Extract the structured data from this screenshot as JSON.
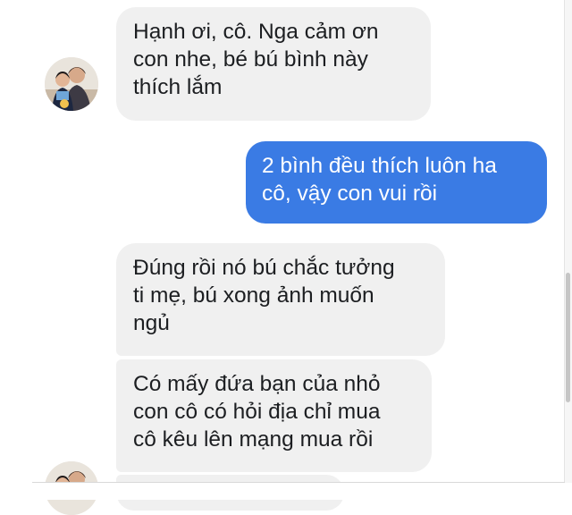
{
  "conversation": {
    "messages": [
      {
        "sender": "contact",
        "text": "Hạnh ơi, cô. Nga cảm ơn\ncon nhe, bé bú bình này\nthích lắm"
      },
      {
        "sender": "me",
        "text": "2 bình đều thích luôn ha\ncô, vậy con vui rồi"
      },
      {
        "sender": "contact",
        "text": "Đúng rồi nó bú chắc tưởng\nti mẹ, bú xong ảnh muốn\nngủ"
      },
      {
        "sender": "contact",
        "text": "Có mấy đứa bạn của nhỏ\ncon cô có hỏi địa chỉ mua\ncô kêu lên mạng mua rồi"
      },
      {
        "sender": "contact",
        "text": ""
      }
    ]
  },
  "colors": {
    "incoming_bubble": "#f0f0f0",
    "outgoing_bubble": "#3a7be4",
    "incoming_text": "#1c1e21",
    "outgoing_text": "#ffffff"
  },
  "icons": {
    "contact_avatar": "contact-avatar-photo"
  }
}
